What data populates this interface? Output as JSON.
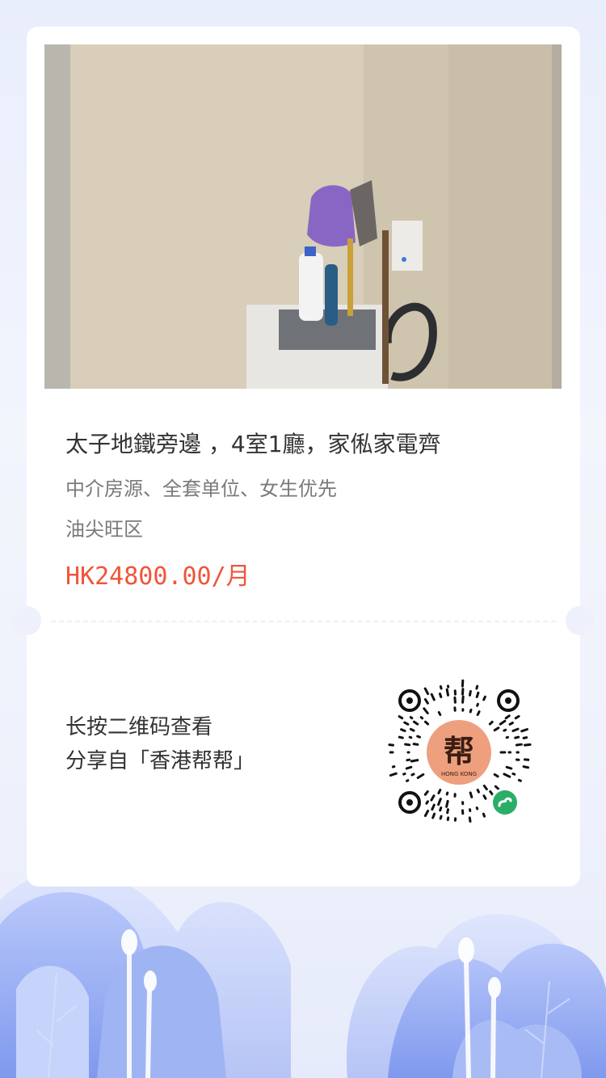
{
  "listing": {
    "title": "太子地鐵旁邊 ，4室1廳，家俬家電齊",
    "tags": "中介房源、全套单位、女生优先",
    "district": "油尖旺区",
    "price": "HK24800.00/月"
  },
  "share": {
    "hint_line1": "长按二维码查看",
    "hint_line2": "分享自「香港帮帮」"
  },
  "qr": {
    "logo_char": "帮",
    "logo_subtext": "HONG KONG"
  },
  "colors": {
    "accent_price": "#f0553b",
    "page_bg": "#eef1fb",
    "tree_blue": "#8ea8f0",
    "wechat_green": "#2aae67"
  }
}
